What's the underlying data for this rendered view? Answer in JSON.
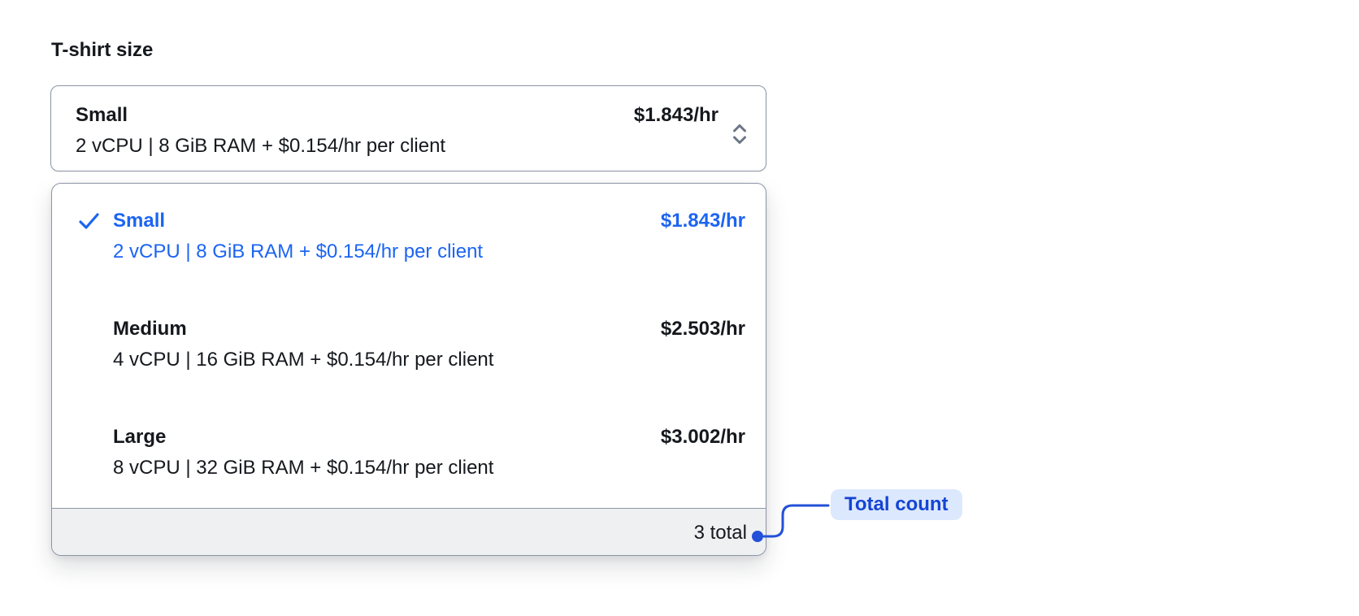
{
  "colors": {
    "accent_blue": "#1c64f2",
    "annotation_blue": "#2350d8",
    "annotation_text_blue": "#1544d4",
    "annotation_pill_bg": "#dce8fd",
    "border_gray": "#8b95a5",
    "footer_bg": "#eef0f2",
    "text_dark": "#15181d"
  },
  "form": {
    "label": "T-shirt size",
    "select": {
      "value_name": "Small",
      "value_specs": "2 vCPU | 8 GiB RAM + $0.154/hr per client",
      "value_price": "$1.843/hr"
    },
    "dropdown": {
      "options": [
        {
          "name": "Small",
          "specs": "2 vCPU | 8 GiB RAM + $0.154/hr per client",
          "price": "$1.843/hr",
          "selected": true
        },
        {
          "name": "Medium",
          "specs": "4 vCPU | 16 GiB RAM + $0.154/hr per client",
          "price": "$2.503/hr",
          "selected": false
        },
        {
          "name": "Large",
          "specs": "8 vCPU | 32 GiB RAM + $0.154/hr per client",
          "price": "$3.002/hr",
          "selected": false
        }
      ],
      "footer": {
        "total_label": "3 total"
      }
    }
  },
  "annotation": {
    "label": "Total count"
  }
}
